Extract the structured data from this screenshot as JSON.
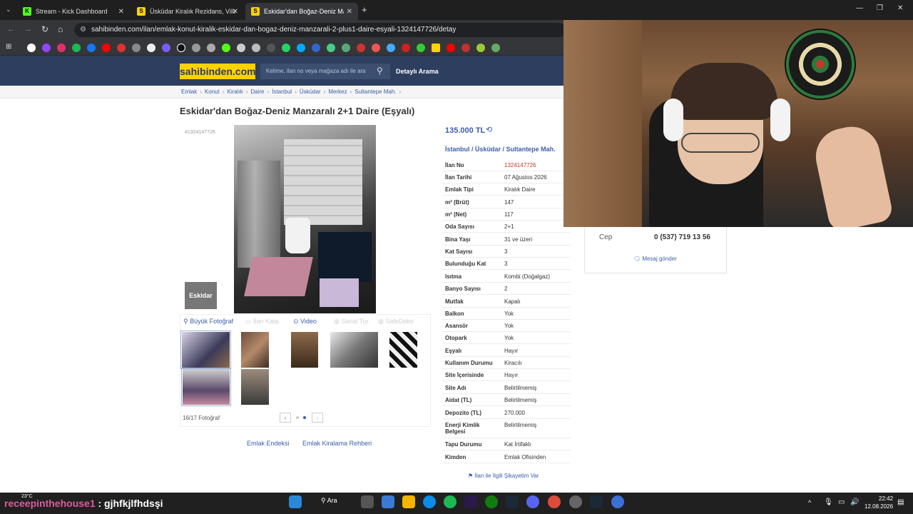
{
  "browser": {
    "tabs": [
      {
        "label": "Stream - Kick Dashboard",
        "favicon": "K",
        "color": "#53fc18"
      },
      {
        "label": "Üsküdar Kiralık Rezidans, Villa, D",
        "favicon": "S",
        "color": "#ffd200"
      },
      {
        "label": "Eskidar'dan Boğaz-Deniz Manz",
        "favicon": "S",
        "color": "#ffd200"
      }
    ],
    "url": "sahibinden.com/ilan/emlak-konut-kiralik-eskidar-dan-bogaz-deniz-manzarali-2-plus1-daire-esyali-1324147726/detay"
  },
  "site": {
    "logo": "sahibinden.com",
    "search_placeholder": "Kelime, ilan no veya mağaza adı ile ara",
    "detailed_search": "Detaylı Arama"
  },
  "breadcrumbs": [
    "Emlak",
    "Konut",
    "Kiralık",
    "Daire",
    "İstanbul",
    "Üsküdar",
    "Merkez",
    "Sultantepe Mah."
  ],
  "listing": {
    "title": "Eskidar'dan Boğaz-Deniz Manzaralı 2+1 Daire (Eşyalı)",
    "ad_no_small": "#1324147726",
    "price": "135.000 TL",
    "location": {
      "city": "İstanbul",
      "district": "Üsküdar",
      "neighborhood": "Sultantepe Mah."
    },
    "photo_logo": "Eskidar",
    "photo_tools": {
      "big_photo": "Büyük Fotoğraf",
      "floor_plan": "İlan Kata",
      "video": "Video",
      "virtual_tour": "Sanal Tur",
      "safe": "SafeDeko"
    },
    "photo_count": "16/17 Fotoğraf",
    "details": [
      {
        "k": "İlan No",
        "v": "1324147726"
      },
      {
        "k": "İlan Tarihi",
        "v": "07 Ağustos 2026"
      },
      {
        "k": "Emlak Tipi",
        "v": "Kiralık Daire"
      },
      {
        "k": "m² (Brüt)",
        "v": "147"
      },
      {
        "k": "m² (Net)",
        "v": "117"
      },
      {
        "k": "Oda Sayısı",
        "v": "2+1"
      },
      {
        "k": "Bina Yaşı",
        "v": "31 ve üzeri"
      },
      {
        "k": "Kat Sayısı",
        "v": "3"
      },
      {
        "k": "Bulunduğu Kat",
        "v": "3"
      },
      {
        "k": "Isıtma",
        "v": "Kombi (Doğalgaz)"
      },
      {
        "k": "Banyo Sayısı",
        "v": "2"
      },
      {
        "k": "Mutfak",
        "v": "Kapalı"
      },
      {
        "k": "Balkon",
        "v": "Yok"
      },
      {
        "k": "Asansör",
        "v": "Yok"
      },
      {
        "k": "Otopark",
        "v": "Yok"
      },
      {
        "k": "Eşyalı",
        "v": "Hayır"
      },
      {
        "k": "Kullanım Durumu",
        "v": "Kiracılı"
      },
      {
        "k": "Site İçerisinde",
        "v": "Hayır"
      },
      {
        "k": "Site Adı",
        "v": "Belirtilmemiş"
      },
      {
        "k": "Aidat (TL)",
        "v": "Belirtilmemiş"
      },
      {
        "k": "Depozito (TL)",
        "v": "270.000"
      },
      {
        "k": "Enerji Kimlik Belgesi",
        "v": "Belirtilmemiş"
      },
      {
        "k": "Tapu Durumu",
        "v": "Kat İrtifaklı"
      },
      {
        "k": "Kimden",
        "v": "Emlak Ofisinden"
      }
    ],
    "complaint": "İlan ile İlgili Şikayetim Var",
    "footer_links": [
      "Emlak Endeksi",
      "Emlak Kiralama Rehberi"
    ]
  },
  "contact": {
    "label": "Cep",
    "phone": "0 (537) 719 13 56",
    "message": "Mesaj gönder"
  },
  "overlay": {
    "chat_user": "receepinthehouse1",
    "chat_message": ": gjhfkjlfhdsşi",
    "weather": "23°C"
  },
  "taskbar": {
    "search": "Ara",
    "time": "22:42",
    "date": "12.08.2026"
  }
}
